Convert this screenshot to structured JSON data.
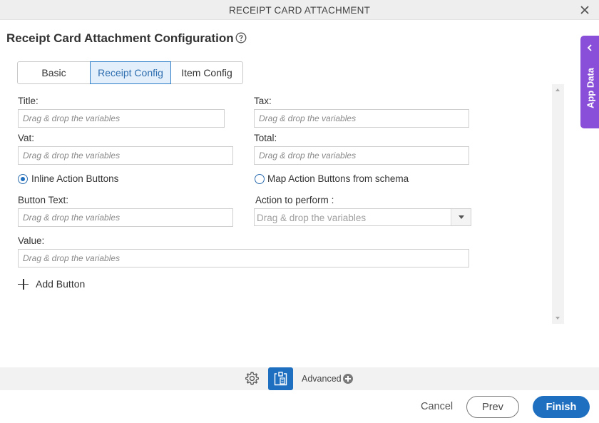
{
  "window": {
    "title": "RECEIPT CARD ATTACHMENT",
    "close_icon": "close-icon"
  },
  "page": {
    "heading": "Receipt Card Attachment Configuration",
    "help_icon": "question-circle-icon"
  },
  "side_panel": {
    "label": "App Data",
    "icon": "chevron-left-icon",
    "color": "#8a4fd8"
  },
  "tabs": [
    {
      "label": "Basic",
      "active": false
    },
    {
      "label": "Receipt Config",
      "active": true
    },
    {
      "label": "Item Config",
      "active": false
    }
  ],
  "form": {
    "title": {
      "label": "Title:",
      "placeholder": "Drag & drop the variables",
      "value": ""
    },
    "tax": {
      "label": "Tax:",
      "placeholder": "Drag & drop the variables",
      "value": ""
    },
    "vat": {
      "label": "Vat:",
      "placeholder": "Drag & drop the variables",
      "value": ""
    },
    "total": {
      "label": "Total:",
      "placeholder": "Drag & drop the variables",
      "value": ""
    },
    "radio_inline": {
      "label": "Inline Action Buttons",
      "checked": true
    },
    "radio_map": {
      "label": "Map Action Buttons from schema",
      "checked": false
    },
    "button_text": {
      "label": "Button Text:",
      "placeholder": "Drag & drop the variables",
      "value": ""
    },
    "action": {
      "label": "Action to perform",
      "separator": ":",
      "selected": "Drag & drop the variables"
    },
    "value": {
      "label": "Value:",
      "placeholder": "Drag & drop the variables",
      "value": ""
    },
    "add_button": {
      "label": "Add Button",
      "icon": "plus-icon"
    }
  },
  "toolbar": {
    "settings_icon": "gear-icon",
    "app_icon": "app-settings-icon",
    "advanced_label": "Advanced",
    "advanced_icon": "plus-circle-icon"
  },
  "footer": {
    "cancel": "Cancel",
    "prev": "Prev",
    "finish": "Finish"
  },
  "colors": {
    "primary": "#1f6fc0",
    "active_tab_bg": "#e3effa",
    "panel_purple": "#8a4fd8"
  }
}
